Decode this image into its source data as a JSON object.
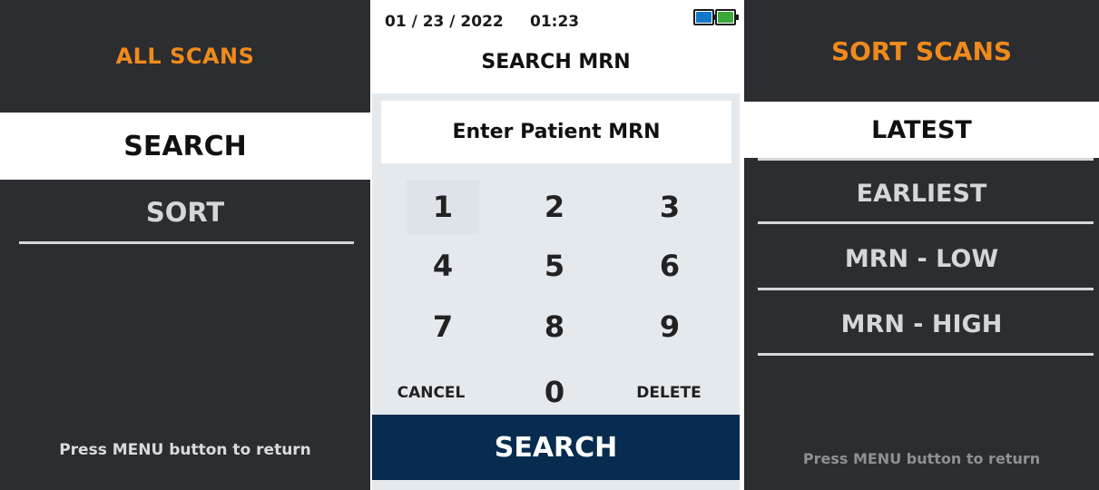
{
  "left_screen": {
    "title": "ALL SCANS",
    "menu_items": [
      "SEARCH",
      "SORT"
    ],
    "selected_item": "SEARCH",
    "footer": "Press MENU button to return"
  },
  "middle_screen": {
    "status_bar": {
      "date": "01 / 23 / 2022",
      "time": "01:23",
      "batteries": [
        {
          "name": "battery-1-icon",
          "color": "#1479c9"
        },
        {
          "name": "battery-2-icon",
          "color": "#3aa83a"
        }
      ]
    },
    "title": "SEARCH MRN",
    "input_placeholder": "Enter Patient MRN",
    "keypad": {
      "keys": [
        "1",
        "2",
        "3",
        "4",
        "5",
        "6",
        "7",
        "8",
        "9"
      ],
      "cancel": "CANCEL",
      "zero": "0",
      "delete": "DELETE"
    },
    "search_button": "SEARCH"
  },
  "right_screen": {
    "title": "SORT SCANS",
    "options": [
      "LATEST",
      "EARLIEST",
      "MRN - LOW",
      "MRN - HIGH"
    ],
    "selected_option": "LATEST",
    "footer": "Press MENU button to return"
  },
  "colors": {
    "background_dark": "#2b2d30",
    "accent_orange": "#f08a1c",
    "search_button_navy": "#072c4f",
    "keypad_background": "#e4e9ed"
  }
}
